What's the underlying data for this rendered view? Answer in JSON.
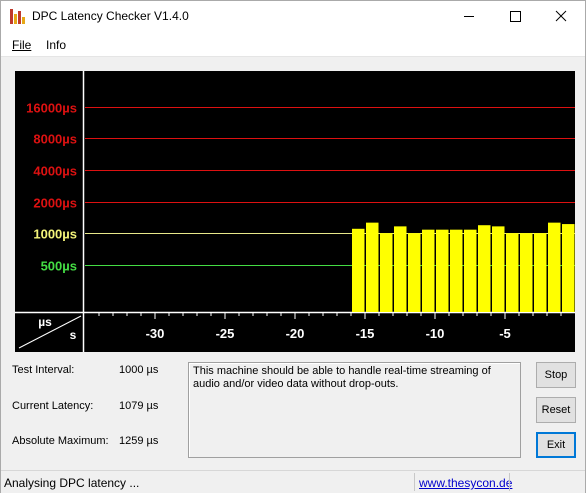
{
  "window": {
    "title": "DPC Latency Checker V1.4.0"
  },
  "menu": {
    "file": "File",
    "info": "Info"
  },
  "chart_data": {
    "type": "bar",
    "y_axis_labels": [
      {
        "text": "16000µs",
        "value": 16000,
        "color": "#dd1111"
      },
      {
        "text": "8000µs",
        "value": 8000,
        "color": "#dd1111"
      },
      {
        "text": "4000µs",
        "value": 4000,
        "color": "#dd1111"
      },
      {
        "text": "2000µs",
        "value": 2000,
        "color": "#dd1111"
      },
      {
        "text": "1000µs",
        "value": 1000,
        "color": "#f4f47a"
      },
      {
        "text": "500µs",
        "value": 500,
        "color": "#44dd44"
      }
    ],
    "x_ticks": [
      "-30",
      "-25",
      "-20",
      "-15",
      "-10",
      "-5"
    ],
    "x_tick_values": [
      -30,
      -25,
      -20,
      -15,
      -10,
      -5
    ],
    "xlim": [
      -35,
      0
    ],
    "ylim_log2": [
      9,
      14
    ],
    "corner_top": "µs",
    "corner_bottom": "s",
    "bar_color": "#ffff00",
    "bars": [
      {
        "x": -15.5,
        "value": 1100
      },
      {
        "x": -14.5,
        "value": 1259
      },
      {
        "x": -13.5,
        "value": 1000
      },
      {
        "x": -12.5,
        "value": 1160
      },
      {
        "x": -11.5,
        "value": 1000
      },
      {
        "x": -10.5,
        "value": 1079
      },
      {
        "x": -9.5,
        "value": 1079
      },
      {
        "x": -8.5,
        "value": 1079
      },
      {
        "x": -7.5,
        "value": 1079
      },
      {
        "x": -6.5,
        "value": 1190
      },
      {
        "x": -5.5,
        "value": 1160
      },
      {
        "x": -4.5,
        "value": 1000
      },
      {
        "x": -3.5,
        "value": 1000
      },
      {
        "x": -2.5,
        "value": 1000
      },
      {
        "x": -1.5,
        "value": 1259
      },
      {
        "x": -0.5,
        "value": 1220
      }
    ]
  },
  "stats": {
    "test_interval_label": "Test Interval:",
    "test_interval_value": "1000 µs",
    "current_latency_label": "Current Latency:",
    "current_latency_value": "1079 µs",
    "absolute_max_label": "Absolute Maximum:",
    "absolute_max_value": "1259 µs"
  },
  "message": "This machine should be able to handle real-time streaming of audio and/or video data without drop-outs.",
  "buttons": {
    "stop": "Stop",
    "reset": "Reset",
    "exit": "Exit"
  },
  "statusbar": {
    "text": "Analysing DPC latency ...",
    "link": "www.thesycon.de"
  }
}
